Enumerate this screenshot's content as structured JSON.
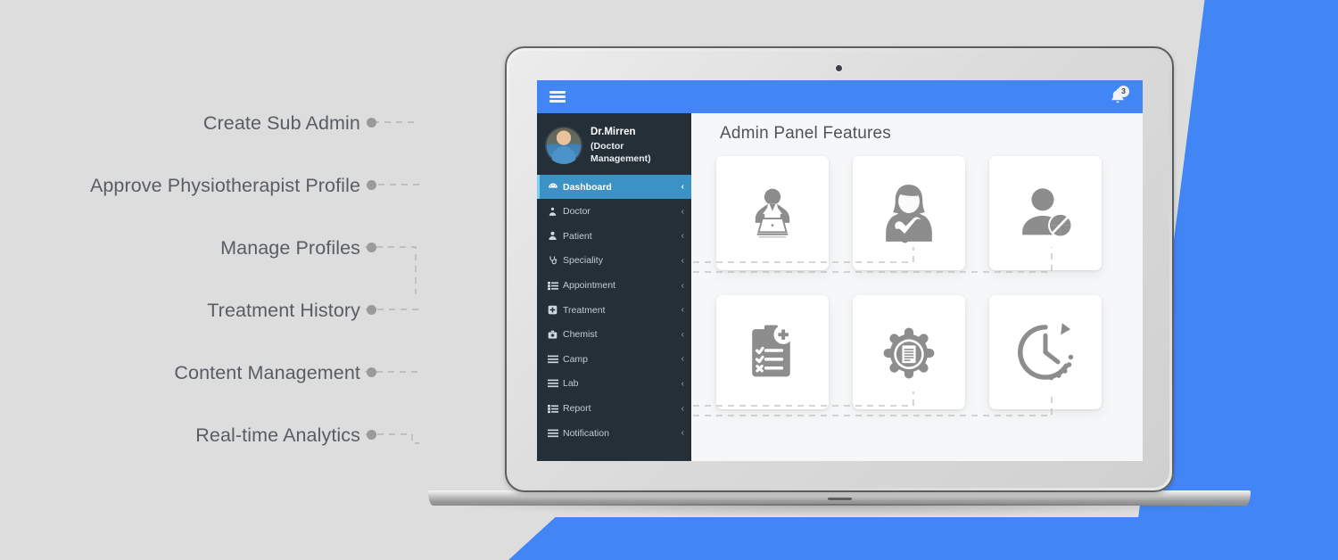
{
  "theme": {
    "page_bg": "#dddddd",
    "accent_blue": "#4285f4",
    "sidebar_bg": "#242f38",
    "sidebar_active": "#3a93c4",
    "label_text": "#575d63",
    "icon_gray": "#8a8a8a",
    "dot_gray": "#9a9a9a",
    "content_bg": "#f6f7f8"
  },
  "callouts": [
    {
      "label": "Create Sub Admin",
      "dot": "bullet-dot"
    },
    {
      "label": "Approve Physiotherapist Profile",
      "dot": "bullet-dot"
    },
    {
      "label": "Manage Profiles",
      "dot": "bullet-dot"
    },
    {
      "label": "Treatment History",
      "dot": "bullet-dot"
    },
    {
      "label": "Content Management",
      "dot": "bullet-dot"
    },
    {
      "label": "Real-time  Analytics",
      "dot": "bullet-dot"
    }
  ],
  "app": {
    "topbar": {
      "menu_icon": "hamburger-icon",
      "notification_icon": "bell-icon",
      "notification_count": "3"
    },
    "sidebar": {
      "profile": {
        "avatar": "doctor-avatar",
        "name": "Dr.Mirren",
        "role": "(Doctor Management)"
      },
      "items": [
        {
          "label": "Dashboard",
          "icon": "dashboard-icon",
          "chevron": "‹",
          "active": true
        },
        {
          "label": "Doctor",
          "icon": "doctor-icon",
          "chevron": "‹",
          "active": false
        },
        {
          "label": "Patient",
          "icon": "patient-icon",
          "chevron": "‹",
          "active": false
        },
        {
          "label": "Speciality",
          "icon": "stethoscope-icon",
          "chevron": "‹",
          "active": false
        },
        {
          "label": "Appointment",
          "icon": "list-icon",
          "chevron": "‹",
          "active": false
        },
        {
          "label": "Treatment",
          "icon": "plus-square-icon",
          "chevron": "‹",
          "active": false
        },
        {
          "label": "Chemist",
          "icon": "medkit-icon",
          "chevron": "‹",
          "active": false
        },
        {
          "label": "Camp",
          "icon": "bars-icon",
          "chevron": "‹",
          "active": false
        },
        {
          "label": "Lab",
          "icon": "bars-icon",
          "chevron": "‹",
          "active": false
        },
        {
          "label": "Report",
          "icon": "list-icon",
          "chevron": "‹",
          "active": false
        },
        {
          "label": "Notification",
          "icon": "bars-icon",
          "chevron": "‹",
          "active": false
        }
      ]
    },
    "main": {
      "title": "Admin Panel Features",
      "cards": [
        {
          "icon": "admin-at-laptop-icon"
        },
        {
          "icon": "female-profile-approved-icon"
        },
        {
          "icon": "manage-user-profile-icon"
        },
        {
          "icon": "medical-checklist-icon"
        },
        {
          "icon": "gear-document-icon"
        },
        {
          "icon": "clock-history-icon"
        }
      ]
    }
  }
}
